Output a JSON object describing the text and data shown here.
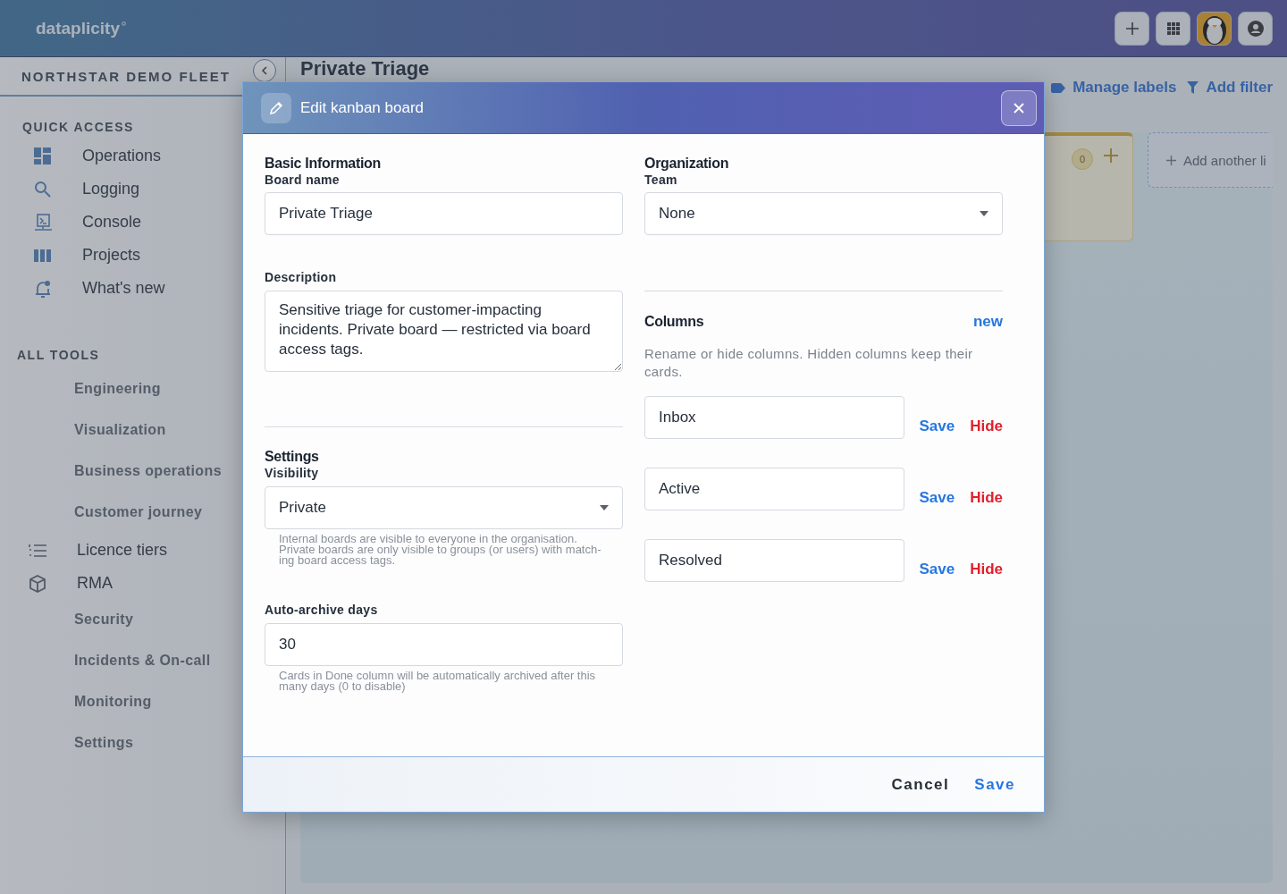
{
  "header": {
    "logo": "dataplicity"
  },
  "sidebar": {
    "fleet": "NORTHSTAR DEMO FLEET",
    "quick_access": {
      "title": "QUICK ACCESS",
      "items": [
        {
          "label": "Operations"
        },
        {
          "label": "Logging"
        },
        {
          "label": "Console"
        },
        {
          "label": "Projects"
        },
        {
          "label": "What's new"
        }
      ]
    },
    "all_tools": {
      "title": "ALL TOOLS",
      "items": [
        {
          "label": "Engineering",
          "kind": "group"
        },
        {
          "label": "Visualization",
          "kind": "group"
        },
        {
          "label": "Business operations",
          "kind": "group"
        },
        {
          "label": "Customer journey",
          "kind": "group"
        },
        {
          "label": "Licence tiers",
          "kind": "link"
        },
        {
          "label": "RMA",
          "kind": "link"
        },
        {
          "label": "Security",
          "kind": "group"
        },
        {
          "label": "Incidents & On-call",
          "kind": "group"
        },
        {
          "label": "Monitoring",
          "kind": "group"
        },
        {
          "label": "Settings",
          "kind": "group"
        }
      ]
    }
  },
  "main": {
    "title": "Private Triage",
    "actions": [
      {
        "label": "Manage labels"
      },
      {
        "label": "Add filter"
      }
    ],
    "board": {
      "count": "0",
      "add_list": "Add another li"
    }
  },
  "modal": {
    "title": "Edit kanban board",
    "basic": {
      "heading": "Basic Information",
      "name_label": "Board name",
      "name_value": "Private Triage",
      "description_label": "Description",
      "description_value": "Sensitive triage for customer-impacting incidents. Private board — restricted via board access tags."
    },
    "settings": {
      "heading": "Settings",
      "visibility_label": "Visibility",
      "visibility_value": "Private",
      "visibility_help": "Internal boards are visible to everyone in the organisation. Private boards are only visible to groups (or users) with match-ing board access tags.",
      "archive_label": "Auto-archive days",
      "archive_value": "30",
      "archive_help": "Cards in Done column will be automatically archived after this many days (0 to disable)"
    },
    "organization": {
      "heading": "Organization",
      "team_label": "Team",
      "team_value": "None"
    },
    "columns": {
      "heading": "Columns",
      "new_link": "new",
      "help": "Rename or hide columns. Hidden columns keep their cards.",
      "rows": [
        {
          "name": "Inbox",
          "save": "Save",
          "hide": "Hide"
        },
        {
          "name": "Active",
          "save": "Save",
          "hide": "Hide"
        },
        {
          "name": "Resolved",
          "save": "Save",
          "hide": "Hide"
        }
      ]
    },
    "footer": {
      "cancel": "Cancel",
      "save": "Save"
    }
  }
}
